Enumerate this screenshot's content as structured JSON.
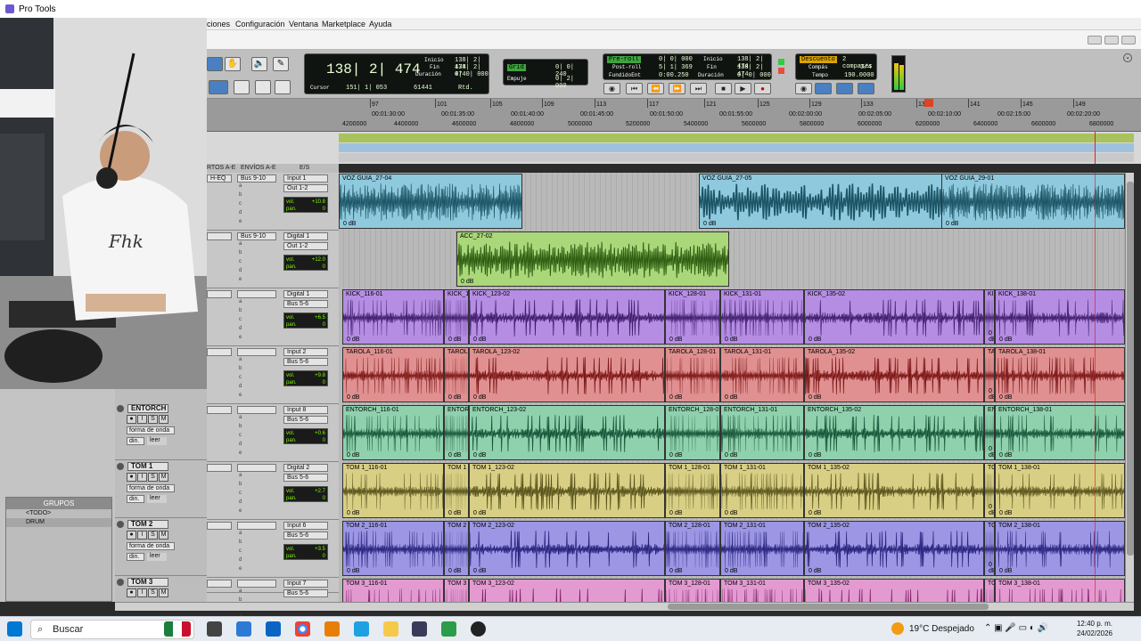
{
  "window": {
    "title": "Pro Tools"
  },
  "menu": [
    "ciones",
    "Configuración",
    "Ventana",
    "Marketplace",
    "Ayuda"
  ],
  "counter": {
    "main": "138| 2| 474",
    "inicio_label": "Inicio",
    "inicio": "138| 2| 474",
    "fin_label": "Fin",
    "fin": "138| 2| 474",
    "duracion_label": "Duración",
    "duracion": "0| 0| 000",
    "cursor_label": "Cursor",
    "cursor": "151| 1| 053",
    "sample": "61441",
    "rtd": "Rtd."
  },
  "grid": {
    "grid_label": "Grid",
    "grid_value": "0| 0| 240",
    "empuje_label": "Empuje",
    "empuje_value": "0| 2| 000"
  },
  "transport": {
    "preroll_label": "Pre-roll",
    "preroll": "0| 0| 000",
    "postroll_label": "Post-roll",
    "postroll": "5| 1| 369",
    "fundido_label": "FundidoEnt",
    "fundido": "0:00.250",
    "inicio_label": "Inicio",
    "inicio": "138| 2| 474",
    "fin_label": "Fin",
    "fin": "138| 2| 474",
    "duracion_label": "Duración",
    "duracion": "0| 0| 000"
  },
  "meter": {
    "descuento_label": "Descuento",
    "descuento": "2 compases",
    "compas_label": "Compás",
    "compas": "3/4",
    "tempo_label": "Tempo",
    "tempo": "190.0000"
  },
  "ruler": {
    "bars": [
      "97",
      "101",
      "105",
      "109",
      "113",
      "117",
      "121",
      "125",
      "129",
      "133",
      "137",
      "141",
      "145",
      "149"
    ],
    "timecodes": [
      "00:01:30:00",
      "00:01:35:00",
      "00:01:40:00",
      "00:01:45:00",
      "00:01:50:00",
      "00:01:55:00",
      "00:02:00:00",
      "00:02:05:00",
      "00:02:10:00",
      "00:02:15:00",
      "00:02:20:00"
    ],
    "samples": [
      "4200000",
      "4400000",
      "4600000",
      "4800000",
      "5000000",
      "5200000",
      "5400000",
      "5600000",
      "5800000",
      "6000000",
      "6200000",
      "6400000",
      "6600000",
      "6800000"
    ]
  },
  "mix_header": {
    "inserts": "RTOS A-E",
    "sends": "ENVÍOS A-E",
    "io": "E/S"
  },
  "io": [
    {
      "insert": "H-EQ",
      "send": "Bus 9-10",
      "input": "Input 1",
      "output": "Out 1-2",
      "vol": "+10.8",
      "pan": "0"
    },
    {
      "insert": "",
      "send": "Bus 9-10",
      "input": "Digital 1",
      "output": "Out 1-2",
      "vol": "+12.0",
      "pan": "0"
    },
    {
      "insert": "",
      "send": "",
      "input": "Digital 1",
      "output": "Bus 5-6",
      "vol": "+6.5",
      "pan": "0"
    },
    {
      "insert": "",
      "send": "",
      "input": "Input 2",
      "output": "Bus 5-6",
      "vol": "+9.8",
      "pan": "0"
    },
    {
      "insert": "",
      "send": "",
      "input": "Input 8",
      "output": "Bus 5-6",
      "vol": "+0.6",
      "pan": "0"
    },
    {
      "insert": "",
      "send": "",
      "input": "Digital 2",
      "output": "Bus 5-6",
      "vol": "+2.7",
      "pan": "0"
    },
    {
      "insert": "",
      "send": "",
      "input": "Input 6",
      "output": "Bus 5-6",
      "vol": "+3.5",
      "pan": "0"
    },
    {
      "insert": "",
      "send": "",
      "input": "Input 7",
      "output": "Bus 5-6",
      "vol": "",
      "pan": ""
    }
  ],
  "io_labels": {
    "vol": "vol.",
    "pan": "pan."
  },
  "track_headers": [
    {
      "name": "ENTORCH",
      "view": "forma de onda",
      "din": "din.",
      "leer": "leer"
    },
    {
      "name": "TOM 1",
      "view": "forma de onda",
      "din": "din.",
      "leer": "leer"
    },
    {
      "name": "TOM 2",
      "view": "forma de onda",
      "din": "din.",
      "leer": "leer"
    },
    {
      "name": "TOM 3",
      "view": "",
      "din": "",
      "leer": ""
    }
  ],
  "track_buttons": [
    "●",
    "I",
    "S",
    "M"
  ],
  "groups": {
    "title": "GRUPOS",
    "items": [
      "<TODO>",
      "DRUM"
    ]
  },
  "clips": {
    "gain": "0 dB",
    "voz": [
      "VOZ GUIA_27-04",
      "VOZ GUIA_27-05",
      "VOZ GUIA_29-01"
    ],
    "acc": [
      "ACC_27-02"
    ],
    "kick": [
      "KICK_116-01",
      "KICK_1",
      "KICK_123-02",
      "KICK_128-01",
      "KICK_131-01",
      "KICK_135-02",
      "KI",
      "KICK_138-01"
    ],
    "tarola": [
      "TAROLA_116-01",
      "TAROL",
      "TAROLA_123-02",
      "TAROLA_128-01",
      "TAROLA_131-01",
      "TAROLA_135-02",
      "TA",
      "TAROLA_138-01"
    ],
    "entorch": [
      "ENTORCH_116-01",
      "ENTOR",
      "ENTORCH_123-02",
      "ENTORCH_128-0",
      "ENTORCH_131-01",
      "ENTORCH_135-02",
      "EN",
      "ENTORCH_138-01"
    ],
    "tom1": [
      "TOM 1_116-01",
      "TOM 1",
      "TOM 1_123-02",
      "TOM 1_128-01",
      "TOM 1_131-01",
      "TOM 1_135-02",
      "TO",
      "TOM 1_138-01"
    ],
    "tom2": [
      "TOM 2_116-01",
      "TOM 2",
      "TOM 2_123-02",
      "TOM 2_128-01",
      "TOM 2_131-01",
      "TOM 2_135-02",
      "TO",
      "TOM 2_138-01"
    ],
    "tom3": [
      "TOM 3_116-01",
      "TOM 3",
      "TOM 3_123-02",
      "TOM 3_128-01",
      "TOM 3_131-01",
      "TOM 3_135-02",
      "TO",
      "TOM 3_138-01"
    ]
  },
  "taskbar": {
    "search": "Buscar",
    "weather": "19°C Despejado",
    "time": "12:40 p. m.",
    "date": "24/02/2026"
  },
  "colors": {
    "voz": "#8ec9dd",
    "acc": "#a9d77a",
    "kick": "#b58de3",
    "tarola": "#e09090",
    "entorch": "#8fd1ad",
    "tom1": "#d8cf85",
    "tom2": "#9c96e4",
    "tom3": "#e39ad1"
  }
}
